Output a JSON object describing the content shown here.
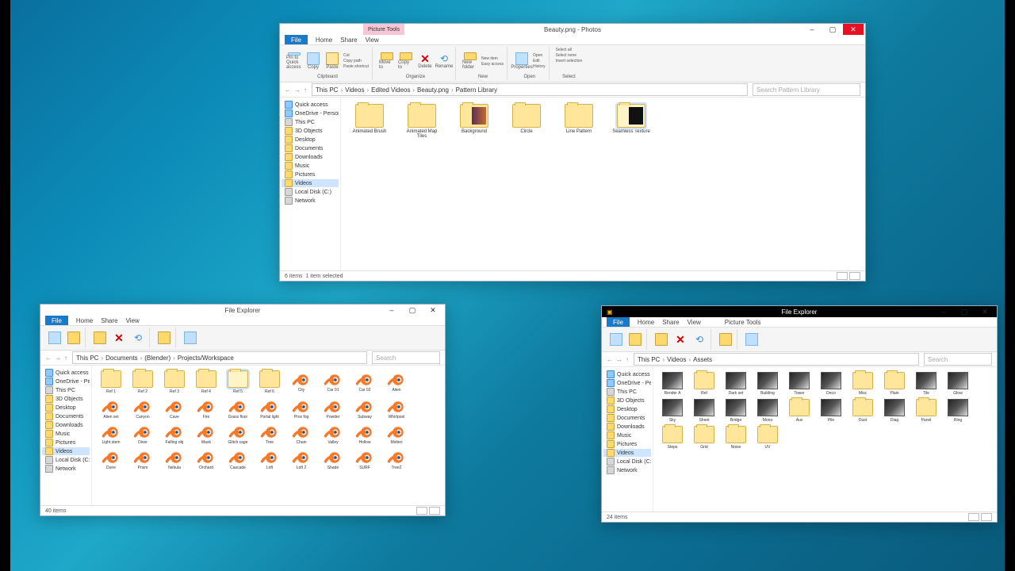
{
  "ribbon": {
    "file": "File",
    "tabs": [
      "Home",
      "Share",
      "View"
    ],
    "pink": "Picture Tools",
    "groups": {
      "clipboard": "Clipboard",
      "organize": "Organize",
      "new": "New",
      "open": "Open",
      "select": "Select"
    },
    "actions": {
      "pin": "Pin to Quick access",
      "copy": "Copy",
      "paste": "Paste",
      "cut": "Cut",
      "copy_path": "Copy path",
      "paste_shortcut": "Paste shortcut",
      "move_to": "Move to",
      "copy_to": "Copy to",
      "delete": "Delete",
      "rename": "Rename",
      "new_folder": "New folder",
      "new_item": "New item",
      "easy_access": "Easy access",
      "properties": "Properties",
      "open": "Open",
      "edit": "Edit",
      "history": "History",
      "select_all": "Select all",
      "select_none": "Select none",
      "invert": "Invert selection"
    }
  },
  "sidebar": {
    "items": [
      {
        "label": "Quick access",
        "type": "star"
      },
      {
        "label": "OneDrive - Personal",
        "type": "star"
      },
      {
        "label": "This PC",
        "type": "pc"
      },
      {
        "label": "3D Objects",
        "type": "folder"
      },
      {
        "label": "Desktop",
        "type": "folder"
      },
      {
        "label": "Documents",
        "type": "folder"
      },
      {
        "label": "Downloads",
        "type": "folder"
      },
      {
        "label": "Music",
        "type": "folder"
      },
      {
        "label": "Pictures",
        "type": "folder"
      },
      {
        "label": "Videos",
        "type": "folder",
        "selected": true
      },
      {
        "label": "Local Disk (C:)",
        "type": "pc"
      },
      {
        "label": "Network",
        "type": "pc"
      }
    ]
  },
  "topWindow": {
    "title": "Beauty.png - Photos",
    "breadcrumb": [
      "This PC",
      "Videos",
      "Edited Videos",
      "Beauty.png",
      "Pattern Library"
    ],
    "search_placeholder": "Search Pattern Library",
    "items": [
      {
        "label": "Animated Brush",
        "type": "folder"
      },
      {
        "label": "Animated Map Tiles",
        "type": "folder"
      },
      {
        "label": "Background",
        "type": "folder-preview2"
      },
      {
        "label": "Circle",
        "type": "folder"
      },
      {
        "label": "Line Pattern",
        "type": "folder"
      },
      {
        "label": "Seamless Texture",
        "type": "folder-preview",
        "selected": true
      }
    ],
    "status_left": "6 items",
    "status_mid": "1 item selected"
  },
  "leftWindow": {
    "title": "File Explorer",
    "breadcrumb": [
      "This PC",
      "Documents",
      "(Blender)",
      "Projects/Workspace"
    ],
    "search_placeholder": "Search",
    "items": [
      {
        "label": "Ref 1",
        "type": "folder"
      },
      {
        "label": "Ref 2",
        "type": "folder"
      },
      {
        "label": "Ref 3",
        "type": "folder"
      },
      {
        "label": "Ref 4",
        "type": "folder"
      },
      {
        "label": "Ref 5",
        "type": "folder",
        "selected": true
      },
      {
        "label": "Ref 6",
        "type": "folder"
      },
      {
        "label": "City",
        "type": "blender"
      },
      {
        "label": "Car 01",
        "type": "blender"
      },
      {
        "label": "Car 02",
        "type": "blender"
      },
      {
        "label": "Alien",
        "type": "blender"
      },
      {
        "label": "Alien set",
        "type": "blender"
      },
      {
        "label": "Canyon",
        "type": "blender"
      },
      {
        "label": "Cave",
        "type": "blender"
      },
      {
        "label": "Fire",
        "type": "blender"
      },
      {
        "label": "Grass floor",
        "type": "blender"
      },
      {
        "label": "Portal light",
        "type": "blender"
      },
      {
        "label": "Prox fog",
        "type": "blender"
      },
      {
        "label": "Powder",
        "type": "blender"
      },
      {
        "label": "Subway",
        "type": "blender"
      },
      {
        "label": "Whirlpool",
        "type": "blender"
      },
      {
        "label": "Light stem",
        "type": "blender"
      },
      {
        "label": "Diver",
        "type": "blender"
      },
      {
        "label": "Falling obj",
        "type": "blender"
      },
      {
        "label": "Mask",
        "type": "blender"
      },
      {
        "label": "Glitch cage",
        "type": "blender"
      },
      {
        "label": "Tree",
        "type": "blender"
      },
      {
        "label": "Chain",
        "type": "blender"
      },
      {
        "label": "Valley",
        "type": "blender"
      },
      {
        "label": "Hollow",
        "type": "blender"
      },
      {
        "label": "Molten",
        "type": "blender"
      },
      {
        "label": "Dune",
        "type": "blender"
      },
      {
        "label": "Prism",
        "type": "blender"
      },
      {
        "label": "Nebula",
        "type": "blender"
      },
      {
        "label": "Orchard",
        "type": "blender"
      },
      {
        "label": "Cascade",
        "type": "blender"
      },
      {
        "label": "Loft",
        "type": "blender"
      },
      {
        "label": "Loft 2",
        "type": "blender"
      },
      {
        "label": "Shade",
        "type": "blender"
      },
      {
        "label": "SURF",
        "type": "blender"
      },
      {
        "label": "Tree2",
        "type": "blender"
      }
    ],
    "status_left": "40 items"
  },
  "rightWindow": {
    "title": "File Explorer",
    "breadcrumb": [
      "This PC",
      "Videos",
      "Assets"
    ],
    "search_placeholder": "Search",
    "items": [
      {
        "label": "Render A",
        "type": "thumb"
      },
      {
        "label": "Ref",
        "type": "folder"
      },
      {
        "label": "Dark set",
        "type": "thumb"
      },
      {
        "label": "Building",
        "type": "thumb"
      },
      {
        "label": "Tower",
        "type": "thumb"
      },
      {
        "label": "Deco",
        "type": "thumb"
      },
      {
        "label": "Misc",
        "type": "folder"
      },
      {
        "label": "Plain",
        "type": "folder"
      },
      {
        "label": "Tile",
        "type": "thumb"
      },
      {
        "label": "Glow",
        "type": "thumb"
      },
      {
        "label": "Sky",
        "type": "thumb"
      },
      {
        "label": "Sheet",
        "type": "thumb"
      },
      {
        "label": "Bridge",
        "type": "thumb"
      },
      {
        "label": "Mono",
        "type": "thumb"
      },
      {
        "label": "Aux",
        "type": "folder"
      },
      {
        "label": "Pile",
        "type": "thumb"
      },
      {
        "label": "Dust",
        "type": "folder"
      },
      {
        "label": "Diag",
        "type": "thumb"
      },
      {
        "label": "Panel",
        "type": "folder"
      },
      {
        "label": "Ring",
        "type": "thumb"
      },
      {
        "label": "Steps",
        "type": "folder"
      },
      {
        "label": "Grid",
        "type": "folder"
      },
      {
        "label": "Noise",
        "type": "folder"
      },
      {
        "label": "UV",
        "type": "folder"
      }
    ],
    "status_left": "24 items"
  }
}
